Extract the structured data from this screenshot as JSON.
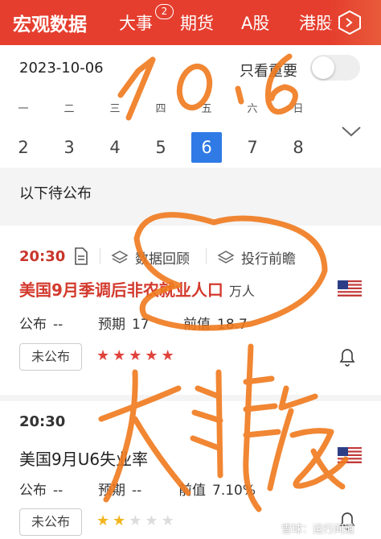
{
  "nav": {
    "tabs": [
      "宏观数据",
      "大事",
      "期货",
      "A股",
      "港股"
    ],
    "active_tab": "宏观数据",
    "badge_count": "2",
    "more_icon": "hexagon-chevron-icon"
  },
  "calendar": {
    "date": "2023-10-06",
    "important_only_label": "只看重要",
    "important_only_on": false,
    "weekdays": [
      "一",
      "二",
      "三",
      "四",
      "五",
      "六",
      "日"
    ],
    "days": [
      "2",
      "3",
      "4",
      "5",
      "6",
      "7",
      "8"
    ],
    "selected_day": "6"
  },
  "section_title": "以下待公布",
  "events": [
    {
      "time": "20:30",
      "links": {
        "review": "数据回顾",
        "preview": "投行前瞻"
      },
      "title": "美国9月季调后非农就业人口",
      "unit": "万人",
      "publish_label": "公布",
      "publish_value": "--",
      "forecast_label": "预期",
      "forecast_value": "17",
      "previous_label": "前值",
      "previous_value": "18.7",
      "status": "未公布",
      "importance": 5,
      "flag": "us-flag-icon"
    },
    {
      "time": "20:30",
      "title": "美国9月U6失业率",
      "publish_label": "公布",
      "publish_value": "--",
      "forecast_label": "预期",
      "forecast_value": "--",
      "previous_label": "前值",
      "previous_value": "7.10%",
      "status": "未公布",
      "importance": 2,
      "flag": "us-flag-icon"
    }
  ],
  "handwriting": {
    "top": "10.6",
    "bottom": "大非农"
  },
  "watermark": "雪球：运行间道",
  "colors": {
    "brand_red": "#e53e2e",
    "selected_blue": "#2f7ae5",
    "ink_orange": "#f07a1e"
  }
}
